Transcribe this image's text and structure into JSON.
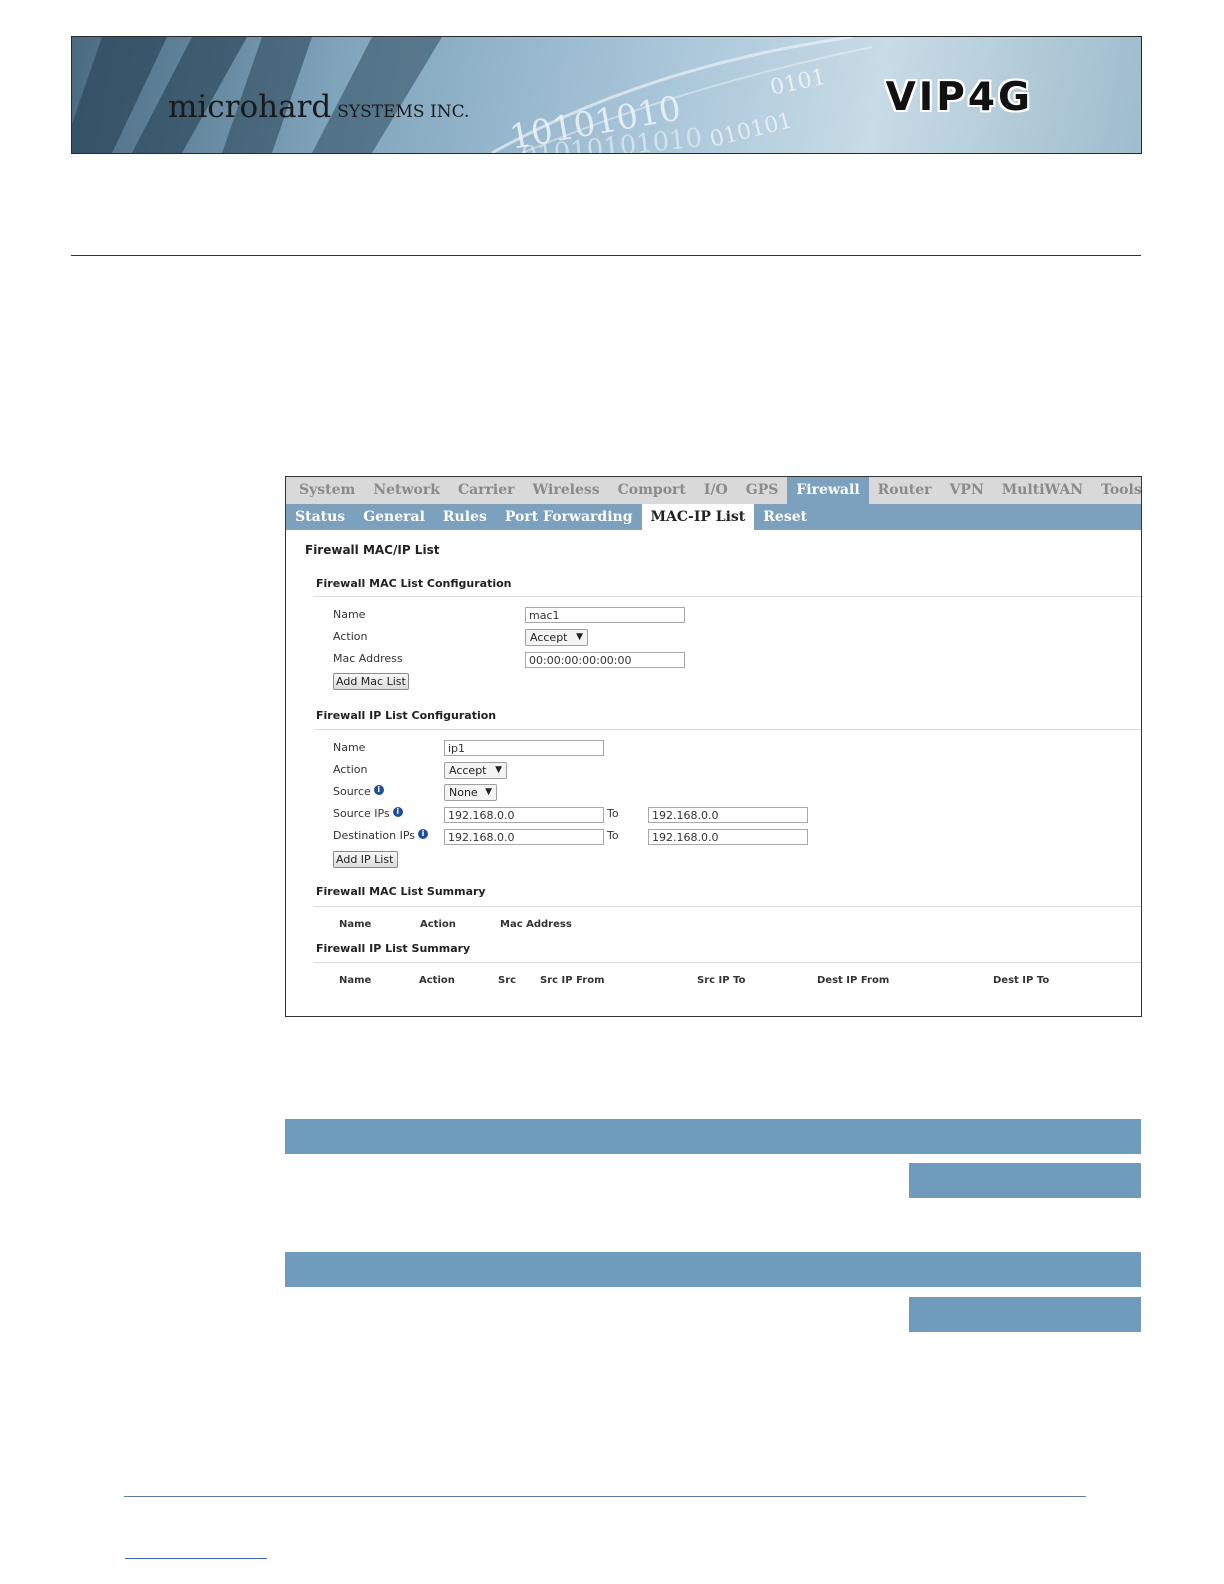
{
  "header": {
    "brand_main": "microhard",
    "brand_sub": "SYSTEMS INC.",
    "product": "VIP4G",
    "binary_1": "0101",
    "binary_2": "10101010",
    "binary_3": "010101",
    "binary_4": "01010101010"
  },
  "screenshot": {
    "main_tabs": [
      "System",
      "Network",
      "Carrier",
      "Wireless",
      "Comport",
      "I/O",
      "GPS",
      "Firewall",
      "Router",
      "VPN",
      "MultiWAN",
      "Tools"
    ],
    "active_main_tab": "Firewall",
    "sub_tabs": [
      "Status",
      "General",
      "Rules",
      "Port Forwarding",
      "MAC-IP List",
      "Reset"
    ],
    "active_sub_tab": "MAC-IP List",
    "panel_title": "Firewall MAC/IP List",
    "mac_config": {
      "title": "Firewall MAC List Configuration",
      "name_label": "Name",
      "name_value": "mac1",
      "action_label": "Action",
      "action_value": "Accept",
      "mac_label": "Mac Address",
      "mac_value": "00:00:00:00:00:00",
      "add_button": "Add Mac List"
    },
    "ip_config": {
      "title": "Firewall IP List Configuration",
      "name_label": "Name",
      "name_value": "ip1",
      "action_label": "Action",
      "action_value": "Accept",
      "source_label": "Source",
      "source_value": "None",
      "source_ips_label": "Source IPs",
      "source_ip_from": "192.168.0.0",
      "source_ip_to": "192.168.0.0",
      "dest_ips_label": "Destination IPs",
      "dest_ip_from": "192.168.0.0",
      "dest_ip_to": "192.168.0.0",
      "to_label": "To",
      "add_button": "Add IP List"
    },
    "mac_summary": {
      "title": "Firewall MAC List Summary",
      "columns": [
        "Name",
        "Action",
        "Mac Address"
      ]
    },
    "ip_summary": {
      "title": "Firewall IP List Summary",
      "columns": [
        "Name",
        "Action",
        "Src",
        "Src IP From",
        "Src IP To",
        "Dest IP From",
        "Dest IP To"
      ]
    }
  }
}
